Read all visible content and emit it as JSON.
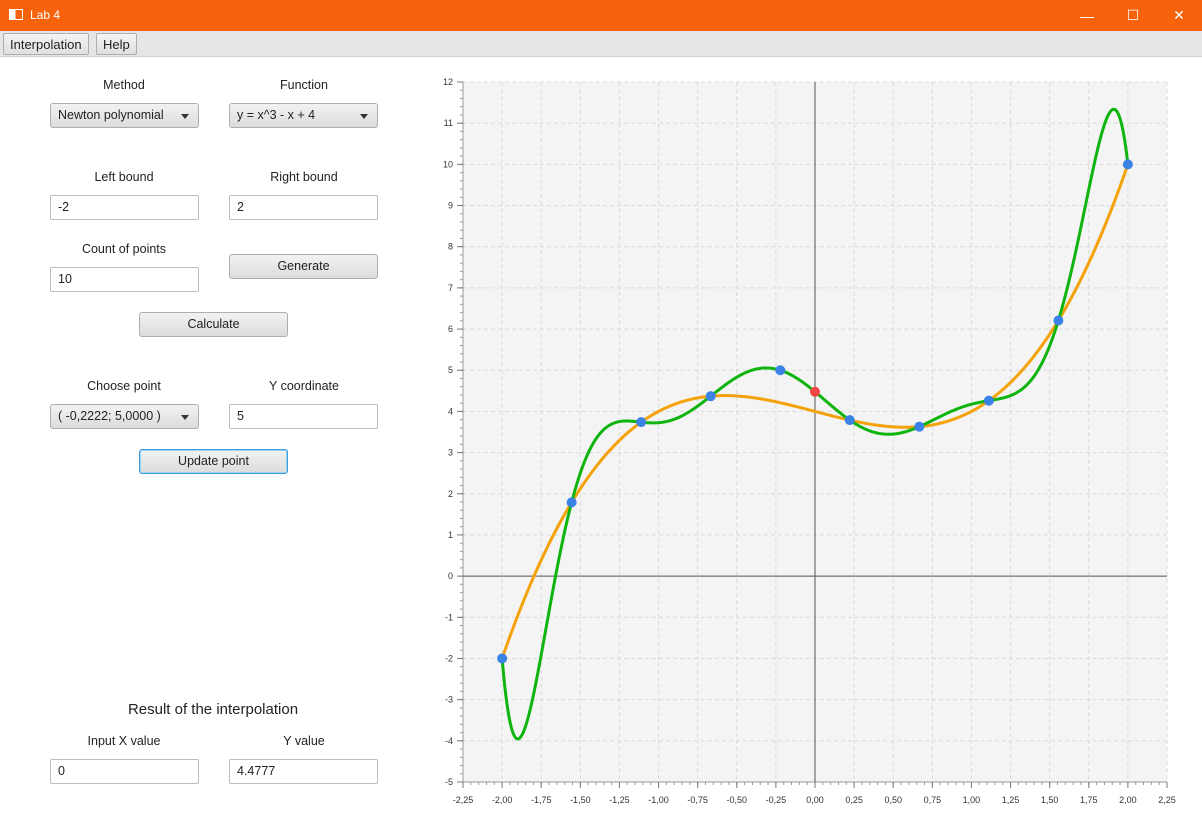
{
  "window": {
    "title": "Lab 4",
    "minimize_glyph": "—",
    "maximize_glyph": "☐",
    "close_glyph": "✕"
  },
  "menu": {
    "items": [
      "Interpolation",
      "Help"
    ]
  },
  "controls": {
    "method_label": "Method",
    "method_value": "Newton polynomial",
    "function_label": "Function",
    "function_value": "y = x^3 - x + 4",
    "left_bound_label": "Left bound",
    "left_bound_value": "-2",
    "right_bound_label": "Right bound",
    "right_bound_value": "2",
    "count_label": "Count of points",
    "count_value": "10",
    "generate_label": "Generate",
    "calculate_label": "Calculate",
    "choose_point_label": "Choose point",
    "choose_point_value": "( -0,2222; 5,0000 )",
    "y_coord_label": "Y coordinate",
    "y_coord_value": "5",
    "update_label": "Update point"
  },
  "result": {
    "title": "Result of the interpolation",
    "input_x_label": "Input X value",
    "input_x_value": "0",
    "y_value_label": "Y value",
    "y_value": "4.4777"
  },
  "colors": {
    "titlebar": "#f7630c",
    "function_curve": "#f5a20a",
    "interp_curve": "#0fb40f",
    "nodes": "#3b82e6",
    "query_point": "#f04545"
  },
  "chart_data": {
    "type": "line",
    "xlim": [
      -2.25,
      2.25
    ],
    "ylim": [
      -5,
      12
    ],
    "x_ticks": [
      "-2,25",
      "-2,00",
      "-1,75",
      "-1,50",
      "-1,25",
      "-1,00",
      "-0,75",
      "-0,50",
      "-0,25",
      "0,00",
      "0,25",
      "0,50",
      "0,75",
      "1,00",
      "1,25",
      "1,50",
      "1,75",
      "2,00",
      "2,25"
    ],
    "y_ticks": [
      "-5",
      "-4",
      "-3",
      "-2",
      "-1",
      "0",
      "1",
      "2",
      "3",
      "4",
      "5",
      "6",
      "7",
      "8",
      "9",
      "10",
      "11",
      "12"
    ],
    "grid": true,
    "series": [
      {
        "kind": "function",
        "color": "#f5a20a"
      },
      {
        "kind": "interpolation",
        "color": "#0fb40f"
      }
    ],
    "nodes": [
      {
        "x": -2.0,
        "y": -2.0
      },
      {
        "x": -1.5556,
        "y": 1.7915
      },
      {
        "x": -1.1111,
        "y": 3.7394
      },
      {
        "x": -0.6667,
        "y": 4.3704
      },
      {
        "x": -0.2222,
        "y": 5.0
      },
      {
        "x": 0.2222,
        "y": 3.7888
      },
      {
        "x": 0.6667,
        "y": 3.6296
      },
      {
        "x": 1.1111,
        "y": 4.2606
      },
      {
        "x": 1.5556,
        "y": 6.2085
      },
      {
        "x": 2.0,
        "y": 10.0
      }
    ],
    "query_point": {
      "x": 0,
      "y": 4.4777
    }
  }
}
